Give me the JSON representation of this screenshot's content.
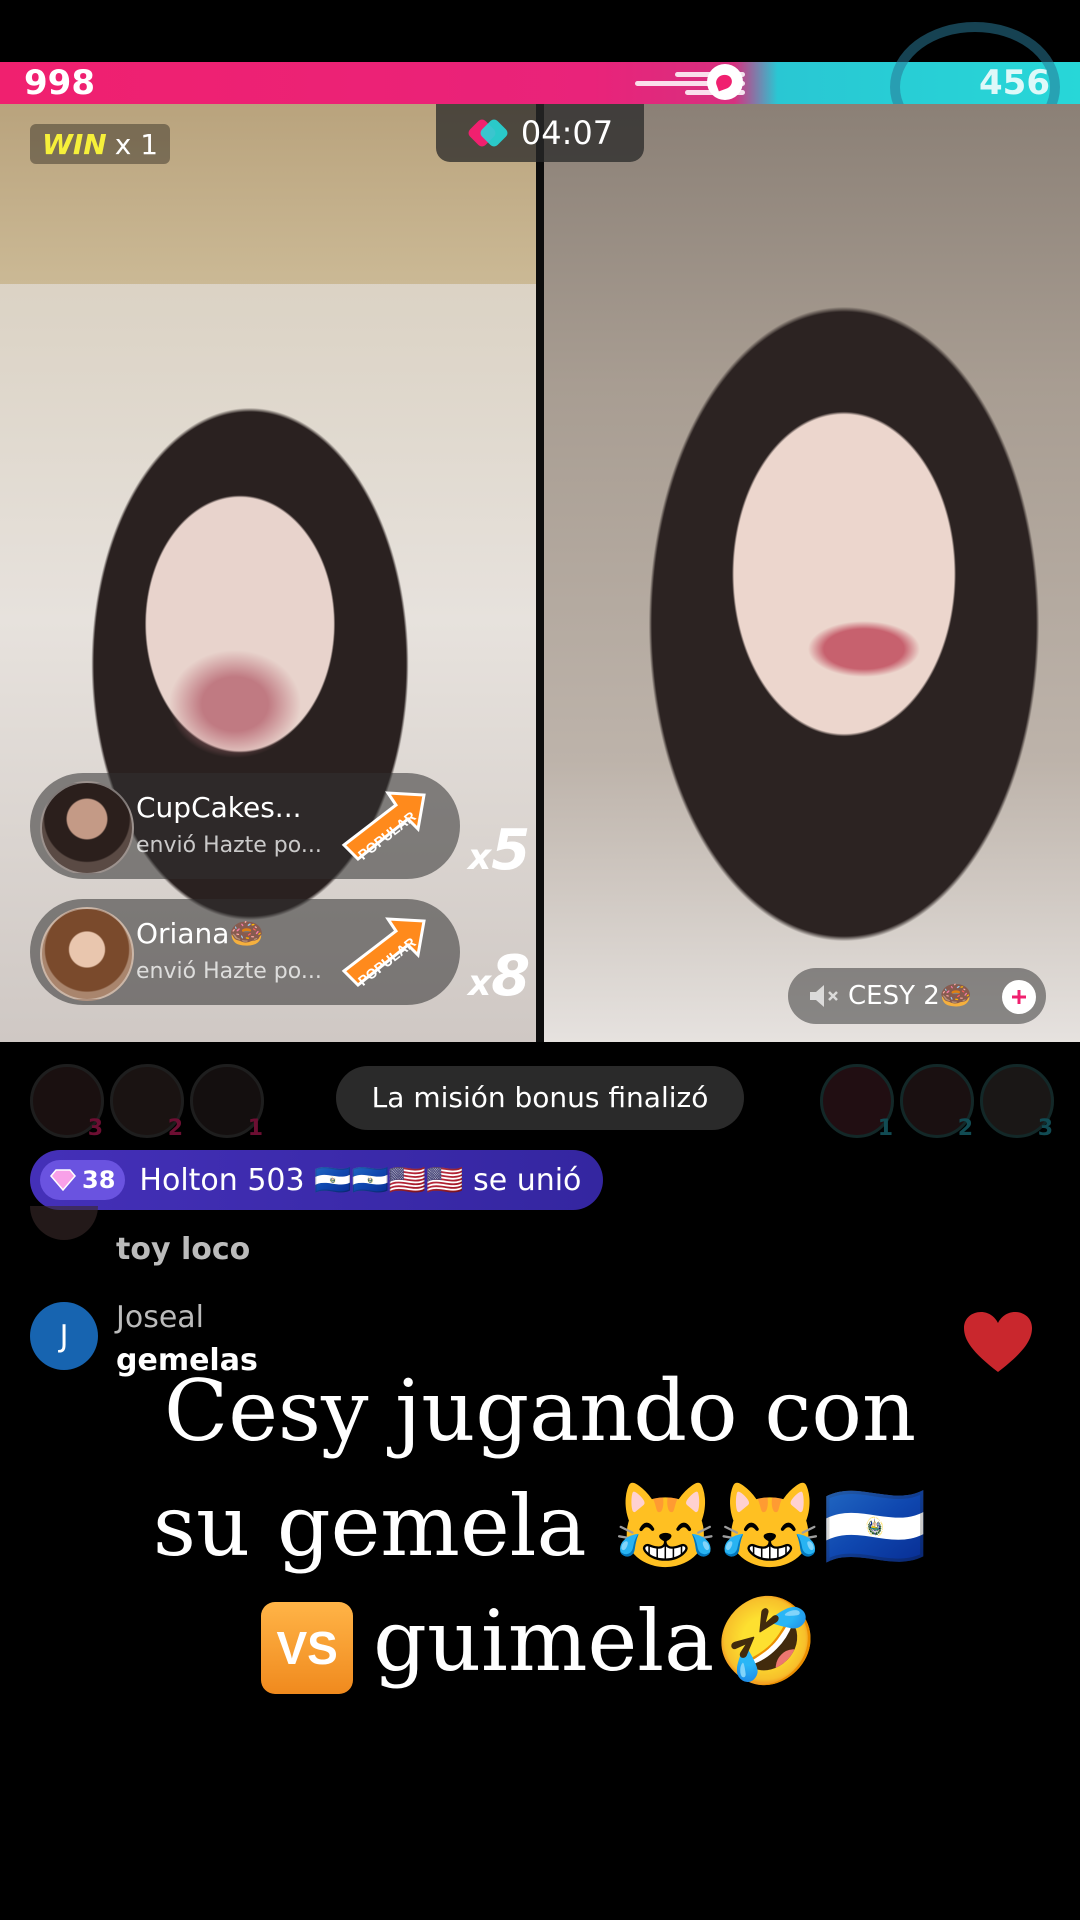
{
  "battle": {
    "score_left": "998",
    "score_right": "456",
    "win_label": "WIN",
    "win_count": "x 1",
    "timer": "04:07",
    "left_color": "#f0206f",
    "right_color": "#27d7d8"
  },
  "gifts": [
    {
      "user": "CupCakes...",
      "action": "envió Hazte po...",
      "badge": "POPULAR",
      "multiplier": "5"
    },
    {
      "user": "Oriana🍩",
      "action": "envió Hazte po...",
      "badge": "POPULAR",
      "multiplier": "8"
    }
  ],
  "cohost": {
    "name": "CESY 2🍩"
  },
  "supporters_left": [
    "3",
    "2",
    "1"
  ],
  "supporters_right": [
    "1",
    "2",
    "3"
  ],
  "mission_text": "La misión bonus finalizó",
  "join_banner": {
    "level": "38",
    "text": "Holton 503 🇸🇻🇸🇻🇺🇸🇺🇸 se unió"
  },
  "chat": [
    {
      "user": "",
      "message": "toy loco"
    },
    {
      "user": "Joseal",
      "initial": "J",
      "message": "gemelas"
    }
  ],
  "caption": {
    "line1": "Cesy jugando con",
    "line2": "su gemela 😹😹🇸🇻",
    "vs": "VS",
    "line3": "guimela🤣"
  }
}
